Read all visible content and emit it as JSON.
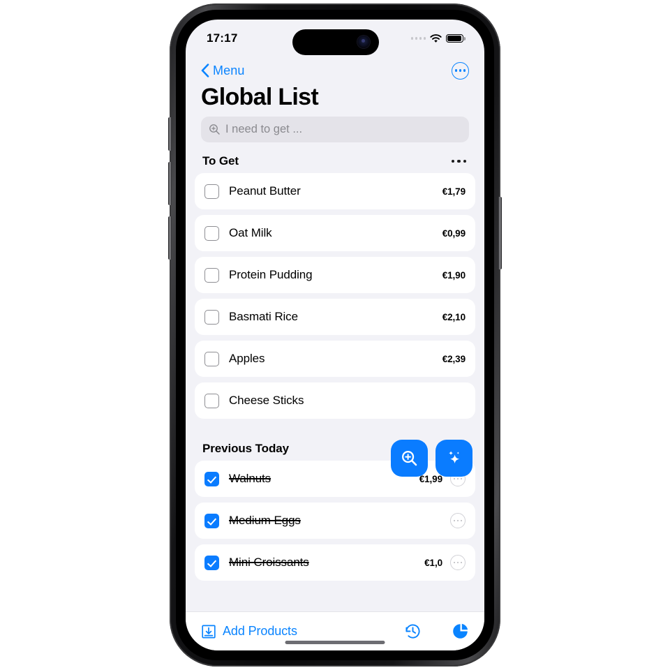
{
  "status_bar": {
    "time": "17:17",
    "cellular_icon": "cellular-dots-icon",
    "wifi_icon": "wifi-icon",
    "battery_icon": "battery-full-icon"
  },
  "nav": {
    "back_label": "Menu",
    "back_icon": "chevron-left-icon",
    "more_icon": "ellipsis-circle-icon"
  },
  "header": {
    "title": "Global List"
  },
  "search": {
    "placeholder": "I need to get ...",
    "value": "",
    "icon": "magnifier-plus-icon"
  },
  "sections": [
    {
      "title": "To Get",
      "more_icon": "ellipsis-icon",
      "items": [
        {
          "label": "Peanut Butter",
          "price": "€1,79",
          "checked": false,
          "has_more": false
        },
        {
          "label": "Oat Milk",
          "price": "€0,99",
          "checked": false,
          "has_more": false
        },
        {
          "label": "Protein Pudding",
          "price": "€1,90",
          "checked": false,
          "has_more": false
        },
        {
          "label": "Basmati Rice",
          "price": "€2,10",
          "checked": false,
          "has_more": false
        },
        {
          "label": "Apples",
          "price": "€2,39",
          "checked": false,
          "has_more": false
        },
        {
          "label": "Cheese Sticks",
          "price": "",
          "checked": false,
          "has_more": false
        }
      ]
    },
    {
      "title": "Previous Today",
      "more_icon": "ellipsis-icon",
      "items": [
        {
          "label": "Walnuts",
          "price": "€1,99",
          "checked": true,
          "has_more": true
        },
        {
          "label": "Medium Eggs",
          "price": "",
          "checked": true,
          "has_more": true
        },
        {
          "label": "Mini Croissants",
          "price": "€1,0",
          "checked": true,
          "has_more": true
        }
      ]
    }
  ],
  "fabs": [
    {
      "name": "scan-product-fab",
      "icon": "magnifier-plus-icon"
    },
    {
      "name": "ai-assistant-fab",
      "icon": "sparkles-icon"
    }
  ],
  "toolbar": {
    "add_products_label": "Add Products",
    "add_products_icon": "tray-arrow-down-icon",
    "history_icon": "clock-arrow-counterclockwise-icon",
    "stats_icon": "pie-chart-icon"
  },
  "colors": {
    "accent_blue": "#0a84ff",
    "fab_blue": "#0a7cff",
    "screen_bg": "#f2f2f7",
    "card_bg": "#ffffff",
    "search_bg": "#e4e3e9"
  }
}
